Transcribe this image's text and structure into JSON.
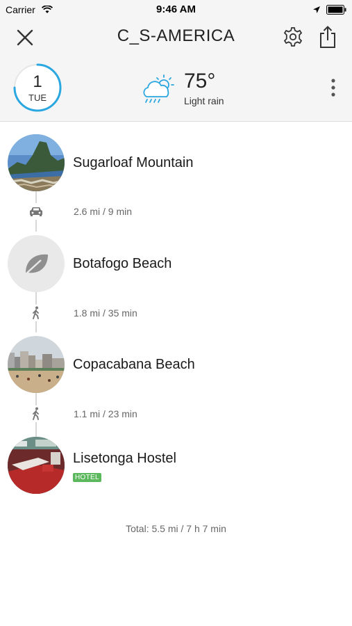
{
  "status_bar": {
    "carrier": "Carrier",
    "time": "9:46 AM",
    "icons": [
      "wifi-icon",
      "location-arrow-icon",
      "battery-icon"
    ]
  },
  "nav": {
    "title": "C_S-AMERICA",
    "icons": [
      "close-icon",
      "gear-icon",
      "share-icon"
    ]
  },
  "day": {
    "number": "1",
    "weekday": "TUE",
    "ring_progress": 0.75,
    "ring_color": "#2aa7e0"
  },
  "weather": {
    "icon": "cloud-sun-rain-icon",
    "icon_color": "#2aa7e0",
    "temperature": "75°",
    "condition": "Light rain"
  },
  "stops": [
    {
      "name": "Sugarloaf Mountain",
      "photo": "sugarloaf-photo",
      "tag": ""
    },
    {
      "name": "Botafogo Beach",
      "photo": "leaf-placeholder-icon",
      "tag": ""
    },
    {
      "name": "Copacabana Beach",
      "photo": "copacabana-photo",
      "tag": ""
    },
    {
      "name": "Lisetonga Hostel",
      "photo": "hostel-photo",
      "tag": "HOTEL"
    }
  ],
  "legs": [
    {
      "mode": "car-icon",
      "distance": "2.6 mi / 9 min"
    },
    {
      "mode": "walk-icon",
      "distance": "1.8 mi / 35 min"
    },
    {
      "mode": "walk-icon",
      "distance": "1.1 mi / 23 min"
    }
  ],
  "total": "Total: 5.5 mi / 7 h 7 min",
  "colors": {
    "accent": "#2aa7e0",
    "hotel_tag": "#5cb85c",
    "header_bg": "#f5f5f5"
  }
}
